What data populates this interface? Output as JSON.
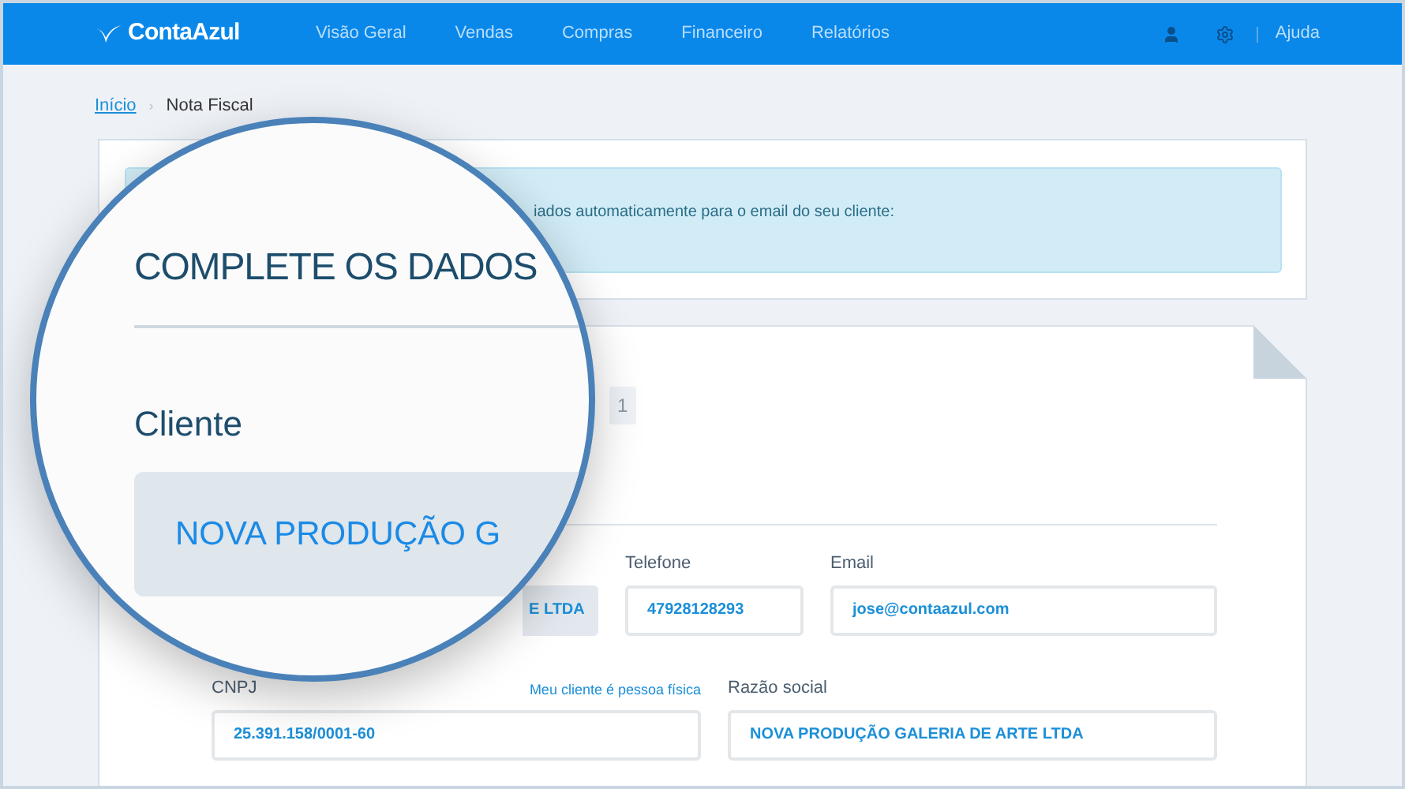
{
  "nav": {
    "logo": "ContaAzul",
    "items": [
      "Visão Geral",
      "Vendas",
      "Compras",
      "Financeiro",
      "Relatórios"
    ],
    "help": "Ajuda"
  },
  "breadcrumb": {
    "link": "Início",
    "separator": "›",
    "current": "Nota Fiscal"
  },
  "banner": {
    "text": "iados automaticamente para o email do seu cliente:"
  },
  "form": {
    "badge": "1",
    "locked_field": {
      "value": "E LTDA"
    },
    "row_1": [
      {
        "label": "Telefone",
        "value": "47928128293"
      },
      {
        "label": "Email",
        "value": "jose@contaazul.com"
      }
    ],
    "row_2": [
      {
        "label": "CNPJ",
        "value": "25.391.158/0001-60",
        "link": "Meu cliente é pessoa física"
      },
      {
        "label": "Razão social",
        "value": "NOVA PRODUÇÃO GALERIA DE ARTE LTDA"
      }
    ]
  },
  "magnifier": {
    "title": "COMPLETE OS DADOS",
    "section": "Cliente",
    "client_name": "NOVA PRODUÇÃO G"
  }
}
